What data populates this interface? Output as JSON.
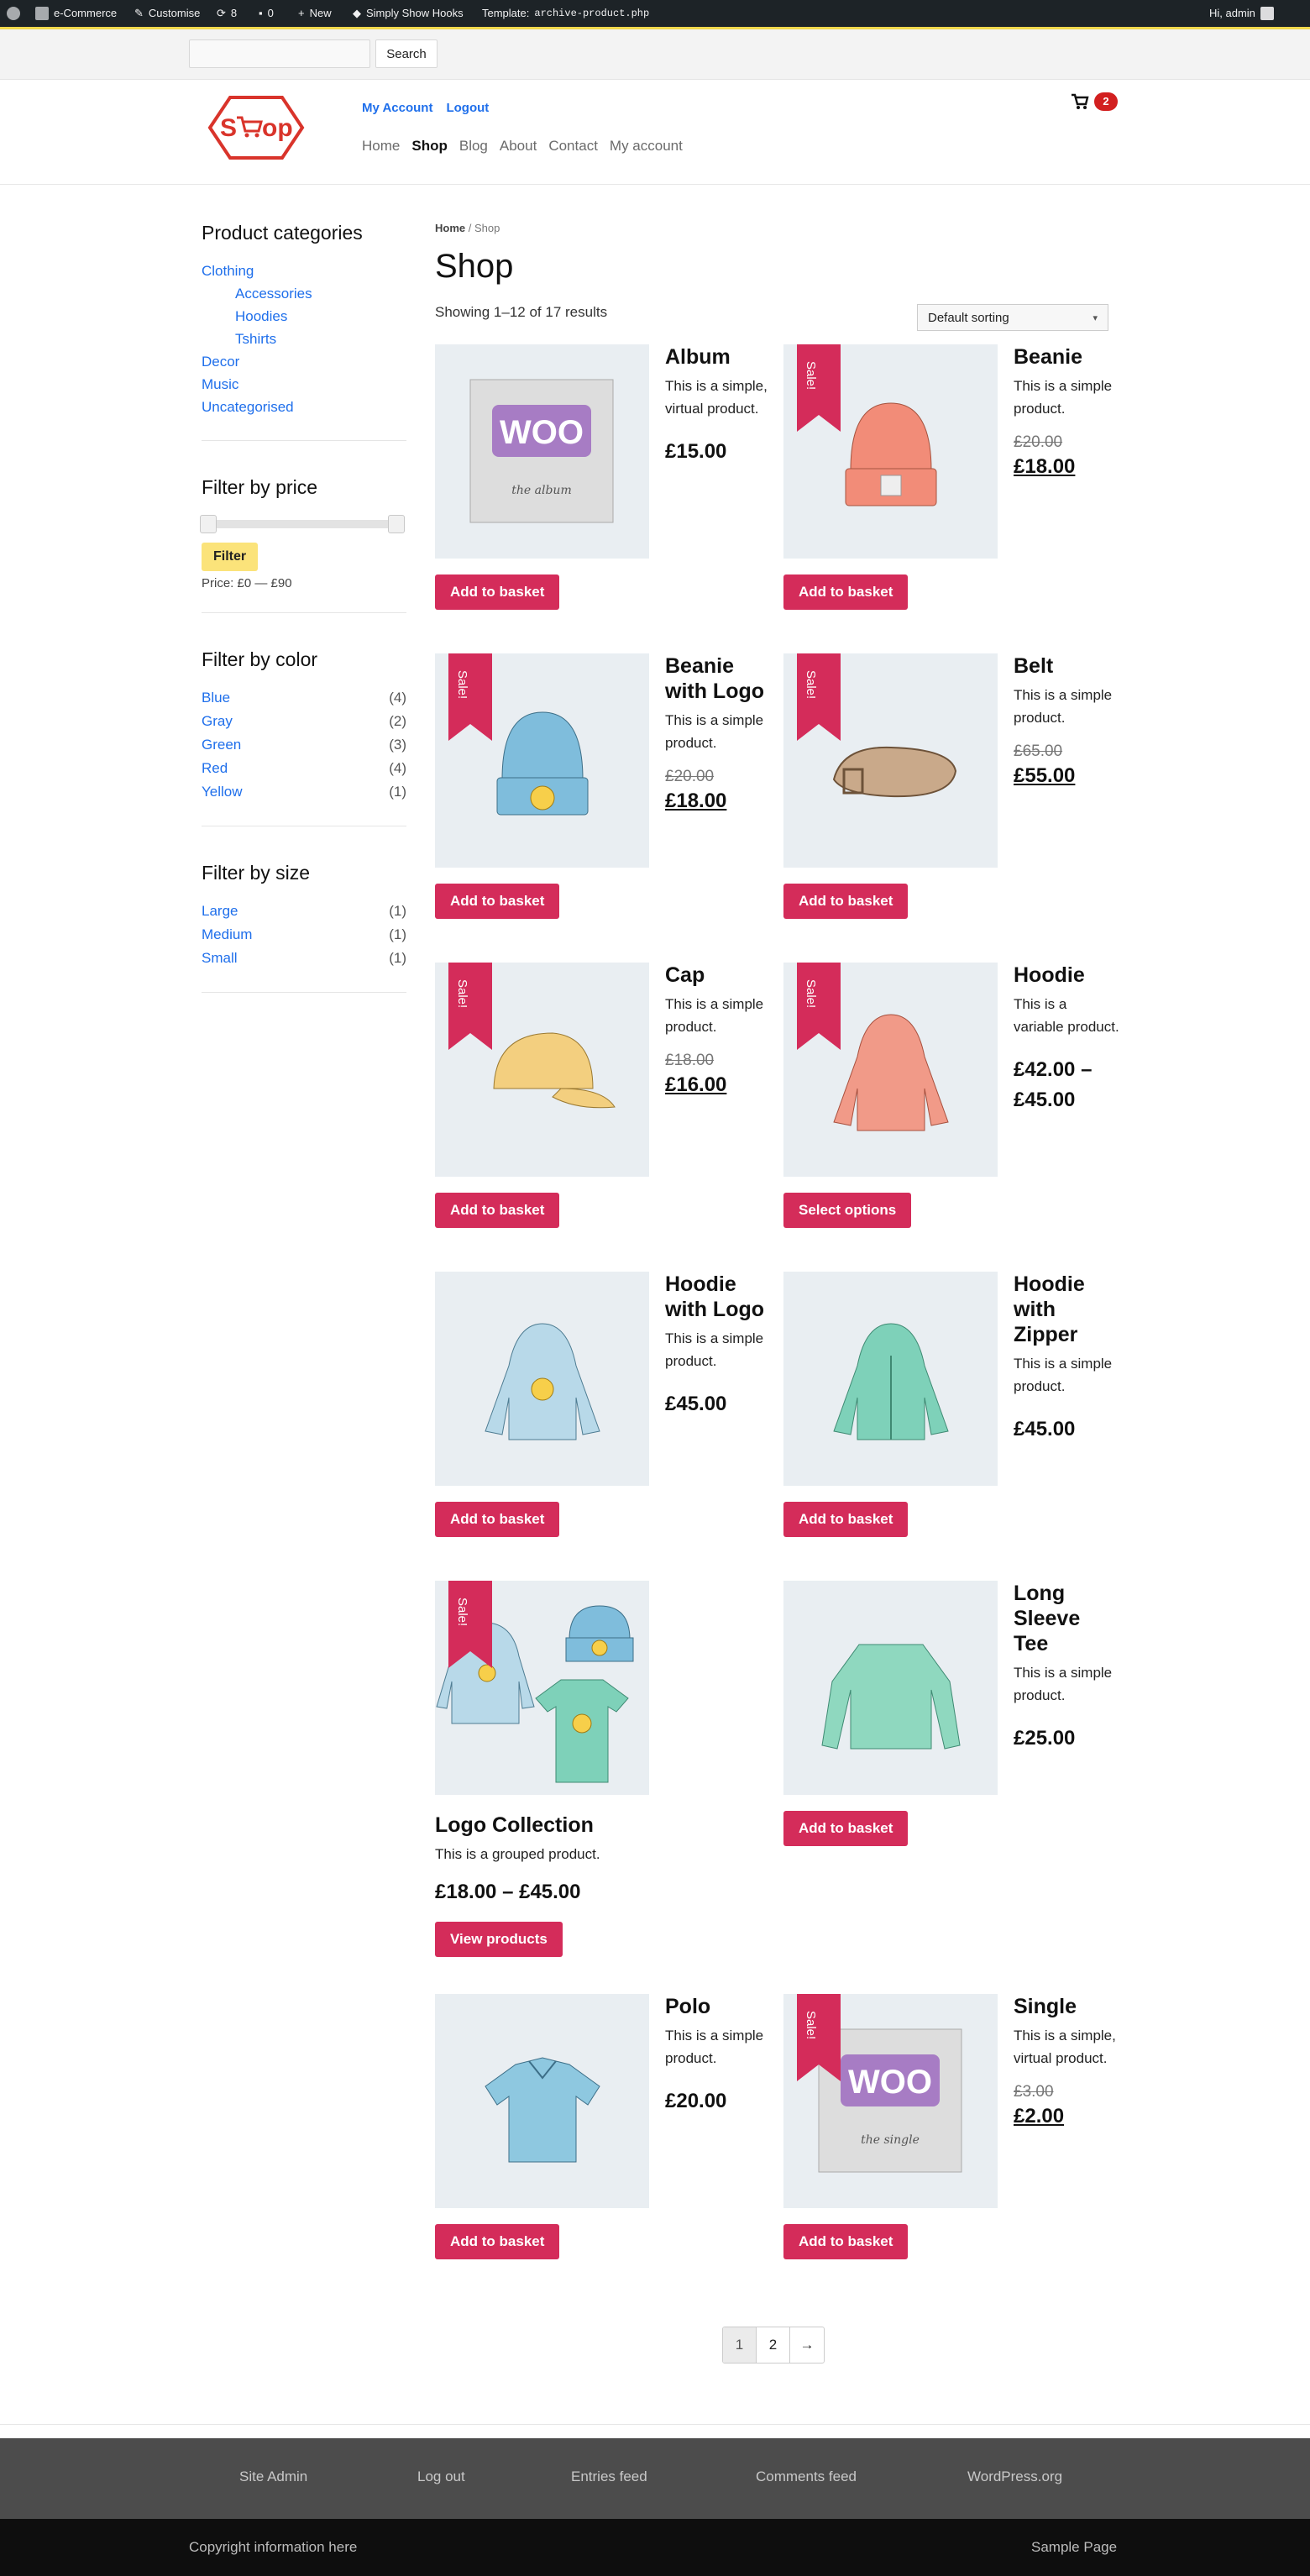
{
  "admin_bar": {
    "site_name": "e-Commerce",
    "customise": "Customise",
    "updates": "8",
    "comments": "0",
    "new": "New",
    "hooks": "Simply Show Hooks",
    "template_label": "Template:",
    "template_file": "archive-product.php",
    "greeting": "Hi, admin"
  },
  "search": {
    "placeholder": "",
    "button": "Search"
  },
  "header": {
    "logo_text": "Shop",
    "links": [
      "My Account",
      "Logout"
    ],
    "nav": [
      "Home",
      "Shop",
      "Blog",
      "About",
      "Contact",
      "My account"
    ],
    "nav_active": "Shop",
    "cart_count": "2"
  },
  "sidebar": {
    "categories_title": "Product categories",
    "categories": [
      {
        "label": "Clothing",
        "sub": false
      },
      {
        "label": "Accessories",
        "sub": true
      },
      {
        "label": "Hoodies",
        "sub": true
      },
      {
        "label": "Tshirts",
        "sub": true
      },
      {
        "label": "Decor",
        "sub": false
      },
      {
        "label": "Music",
        "sub": false
      },
      {
        "label": "Uncategorised",
        "sub": false
      }
    ],
    "price_title": "Filter by price",
    "price_button": "Filter",
    "price_label": "Price: £0 — £90",
    "color_title": "Filter by color",
    "colors": [
      {
        "label": "Blue",
        "count": "(4)"
      },
      {
        "label": "Gray",
        "count": "(2)"
      },
      {
        "label": "Green",
        "count": "(3)"
      },
      {
        "label": "Red",
        "count": "(4)"
      },
      {
        "label": "Yellow",
        "count": "(1)"
      }
    ],
    "size_title": "Filter by size",
    "sizes": [
      {
        "label": "Large",
        "count": "(1)"
      },
      {
        "label": "Medium",
        "count": "(1)"
      },
      {
        "label": "Small",
        "count": "(1)"
      }
    ]
  },
  "main": {
    "breadcrumb_home": "Home",
    "breadcrumb_sep": " / ",
    "breadcrumb_current": "Shop",
    "title": "Shop",
    "result_count": "Showing 1–12 of 17 results",
    "ordering": "Default sorting"
  },
  "sale_label": "Sale!",
  "products": [
    {
      "title": "Album",
      "desc": "This is a simple, virtual product.",
      "old_price": "",
      "price": "£15.00",
      "button": "Add to basket",
      "sale": false,
      "image": "album"
    },
    {
      "title": "Beanie",
      "desc": "This is a simple product.",
      "old_price": "£20.00",
      "price": "£18.00",
      "button": "Add to basket",
      "sale": true,
      "image": "beanie"
    },
    {
      "title": "Beanie with Logo",
      "desc": "This is a simple product.",
      "old_price": "£20.00",
      "price": "£18.00",
      "button": "Add to basket",
      "sale": true,
      "image": "beanie-logo"
    },
    {
      "title": "Belt",
      "desc": "This is a simple product.",
      "old_price": "£65.00",
      "price": "£55.00",
      "button": "Add to basket",
      "sale": true,
      "image": "belt"
    },
    {
      "title": "Cap",
      "desc": "This is a simple product.",
      "old_price": "£18.00",
      "price": "£16.00",
      "button": "Add to basket",
      "sale": true,
      "image": "cap"
    },
    {
      "title": "Hoodie",
      "desc": "This is a variable product.",
      "old_price": "",
      "price": "£42.00 – £45.00",
      "button": "Select options",
      "sale": true,
      "image": "hoodie"
    },
    {
      "title": "Hoodie with Logo",
      "desc": "This is a simple product.",
      "old_price": "",
      "price": "£45.00",
      "button": "Add to basket",
      "sale": false,
      "image": "hoodie-logo"
    },
    {
      "title": "Hoodie with Zipper",
      "desc": "This is a simple product.",
      "old_price": "",
      "price": "£45.00",
      "button": "Add to basket",
      "sale": false,
      "image": "hoodie-zipper"
    },
    {
      "title": "Logo Collection",
      "desc": "This is a grouped product.",
      "old_price": "",
      "price": "£18.00 – £45.00",
      "button": "View products",
      "sale": true,
      "image": "logo-collection"
    },
    {
      "title": "Long Sleeve Tee",
      "desc": "This is a simple product.",
      "old_price": "",
      "price": "£25.00",
      "button": "Add to basket",
      "sale": false,
      "image": "long-sleeve"
    },
    {
      "title": "Polo",
      "desc": "This is a simple product.",
      "old_price": "",
      "price": "£20.00",
      "button": "Add to basket",
      "sale": false,
      "image": "polo"
    },
    {
      "title": "Single",
      "desc": "This is a simple, virtual product.",
      "old_price": "£3.00",
      "price": "£2.00",
      "button": "Add to basket",
      "sale": true,
      "image": "single"
    }
  ],
  "pagination": [
    "1",
    "2",
    "→"
  ],
  "footer": {
    "links": [
      "Site Admin",
      "Log out",
      "Entries feed",
      "Comments feed",
      "WordPress.org"
    ],
    "copyright": "Copyright information here",
    "sample_page": "Sample Page"
  },
  "colors": {
    "accent": "#d42c5a",
    "link": "#1f6feb",
    "filter_button": "#fbe37a",
    "cart_badge": "#d21f1f"
  }
}
